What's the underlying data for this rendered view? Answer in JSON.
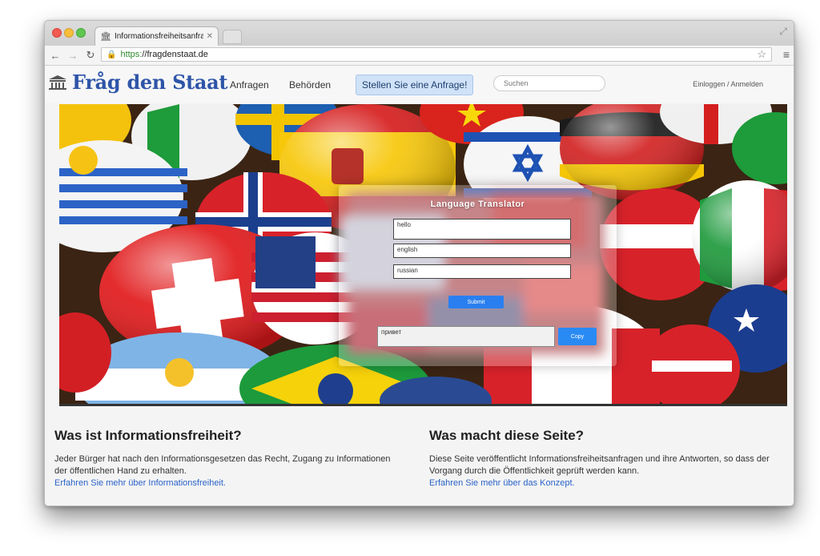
{
  "browser": {
    "tab_title": "Informationsfreiheitsanfrag",
    "url_scheme": "https:",
    "url_host": "//fragdenstaat.de"
  },
  "site": {
    "logo_text": "Fråg den Staat",
    "nav": [
      "Anfragen",
      "Behörden"
    ],
    "cta_label": "Stellen Sie eine Anfrage!",
    "search_placeholder": "Suchen",
    "login_label": "Einloggen / Anmelden"
  },
  "translator": {
    "title": "Language Translator",
    "text_value": "hello",
    "from_language": "english",
    "to_language": "russian",
    "submit_label": "Submit",
    "output_value": "привет",
    "copy_label": "Copy"
  },
  "info": {
    "left": {
      "heading": "Was ist Informationsfreiheit?",
      "body": "Jeder Bürger hat nach den Informationsgesetzen das Recht, Zugang zu Informationen der öffentlichen Hand zu erhalten.",
      "link": "Erfahren Sie mehr über Informationsfreiheit."
    },
    "right": {
      "heading": "Was macht diese Seite?",
      "body": "Diese Seite veröffentlicht Informationsfreiheitsanfragen und ihre Antworten, so dass der Vorgang durch die Öffentlichkeit geprüft werden kann.",
      "link": "Erfahren Sie mehr über das Konzept."
    }
  }
}
